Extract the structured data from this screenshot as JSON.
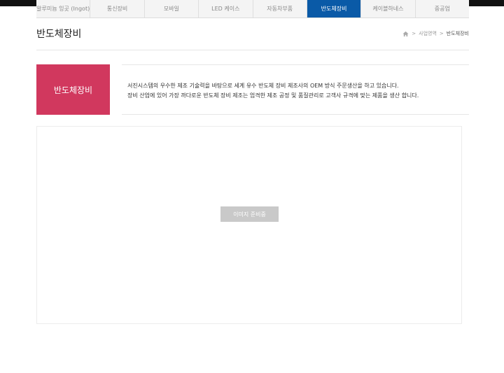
{
  "nav": {
    "tabs": [
      {
        "label": "알루미늄 잉곳 (Ingot)"
      },
      {
        "label": "통신장비"
      },
      {
        "label": "모바일"
      },
      {
        "label": "LED 케이스"
      },
      {
        "label": "자동차부품"
      },
      {
        "label": "반도체장비",
        "active": true
      },
      {
        "label": "케이블하네스"
      },
      {
        "label": "중공업"
      }
    ]
  },
  "header": {
    "title": "반도체장비",
    "breadcrumb": {
      "home_icon": "home-icon",
      "separator": ">",
      "section": "사업영역",
      "current": "반도체장비"
    }
  },
  "intro": {
    "box_label": "반도체장비",
    "box_color": "#d1385e",
    "lines": [
      "서진시스템의 우수한 제조 기술력을 바탕으로 세계 유수 반도체 장비 제조사의 OEM 방식 주문생산을 하고 있습니다.",
      "장비 산업에 있어 가장 까다로운 반도체 장비 제조는 엄격한 제조 공정 및 품질관리로 고객사 규격에 맞는 제품을 생산 합니다."
    ]
  },
  "image_panel": {
    "placeholder": "이미지 준비중"
  },
  "colors": {
    "active_tab": "#0a5aa7",
    "accent": "#d1385e"
  }
}
